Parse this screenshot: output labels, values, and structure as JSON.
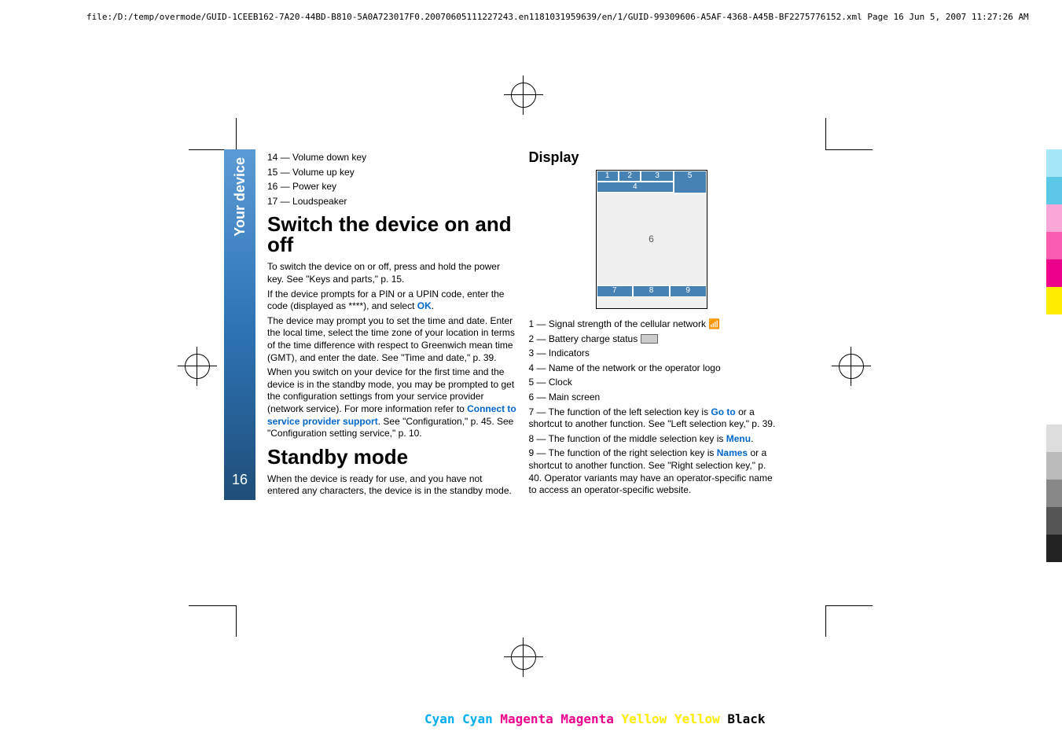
{
  "header": {
    "path": "file:/D:/temp/overmode/GUID-1CEEB162-7A20-44BD-B810-5A0A723017F0.20070605111227243.en1181031959639/en/1/GUID-99309606-A5AF-4368-A45B-BF2275776152.xml    Page 16    Jun 5, 2007 11:27:26 AM"
  },
  "sidebar": {
    "label": "Your device",
    "page_number": "16"
  },
  "left_col": {
    "list": {
      "item14": "14 — Volume down key",
      "item15": "15 — Volume up key",
      "item16": "16 — Power key",
      "item17": "17 — Loudspeaker"
    },
    "heading1": "Switch the device on and off",
    "p1": "To switch the device on or off, press and hold the power key. See \"Keys and parts,\" p. 15.",
    "p2a": "If the device prompts for a PIN or a UPIN code, enter the code (displayed as ****), and select ",
    "p2b": "OK",
    "p2c": ".",
    "p3": "The device may prompt you to set the time and date. Enter the local time, select the time zone of your location in terms of the time difference with respect to Greenwich mean time (GMT), and enter the date. See \"Time and date,\" p. 39.",
    "p4a": "When you switch on your device for the first time and the device is in the standby mode, you may be prompted to get the configuration settings from your service provider (network service). For more information refer to ",
    "p4b": "Connect to service provider support",
    "p4c": ". See \"Configuration,\" p. 45. See \"Configuration setting service,\" p. 10.",
    "heading2": "Standby mode",
    "p5": "When the device is ready for use, and you have not entered any characters, the device is in the standby mode."
  },
  "right_col": {
    "heading": "Display",
    "diagram": {
      "c1": "1",
      "c2": "2",
      "c3": "3",
      "c5": "5",
      "c4": "4",
      "c6": "6",
      "c7": "7",
      "c8": "8",
      "c9": "9"
    },
    "item1": "1 — Signal strength of the cellular network ",
    "item2": "2 — Battery charge status ",
    "item3": "3 — Indicators",
    "item4": "4 — Name of the network or the operator logo",
    "item5": "5 — Clock",
    "item6": "6 — Main screen",
    "item7a": "7 — The function of the left selection key is ",
    "item7b": "Go to",
    "item7c": " or a shortcut to another function. See \"Left selection key,\" p. 39.",
    "item8a": "8 — The function of the middle selection key is ",
    "item8b": "Menu",
    "item8c": ".",
    "item9a": "9 — The function of the right selection key is ",
    "item9b": "Names",
    "item9c": " or a shortcut to another function. See \"Right selection key,\" p. 40. Operator variants may have an operator-specific name to access an operator-specific website."
  },
  "footer": {
    "c": "Cyan",
    "m": "Magenta",
    "y": "Yellow",
    "k": "Black"
  }
}
